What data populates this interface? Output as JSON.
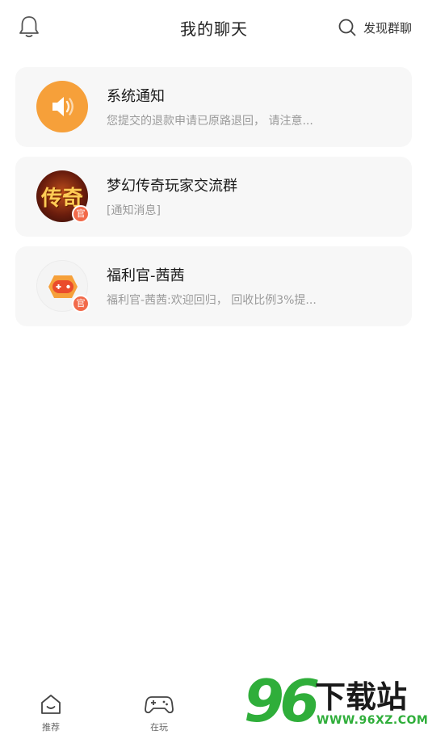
{
  "header": {
    "title": "我的聊天",
    "discover_label": "发现群聊"
  },
  "chats": [
    {
      "name": "系统通知",
      "preview": "您提交的退款申请已原路退回， 请注意...",
      "avatar": "speaker-icon",
      "official": false
    },
    {
      "name": "梦幻传奇玩家交流群",
      "preview": "[通知消息]",
      "avatar": "game-avatar",
      "avatar_text": "传奇",
      "official": true,
      "badge": "官"
    },
    {
      "name": "福利官-茜茜",
      "preview": "福利官-茜茜:欢迎回归， 回收比例3%提...",
      "avatar": "gamepad-avatar",
      "official": true,
      "badge": "官"
    }
  ],
  "bottom_nav": [
    {
      "label": "推荐",
      "icon": "home-icon"
    },
    {
      "label": "在玩",
      "icon": "gamepad-icon"
    }
  ],
  "watermark": {
    "digits": "96",
    "text": "下载站",
    "url": "WWW.96XZ.COM"
  },
  "colors": {
    "accent_orange": "#f6a03a",
    "badge_red": "#f26a4a",
    "watermark_green": "#2fae3a",
    "card_bg": "#f7f7f7"
  }
}
